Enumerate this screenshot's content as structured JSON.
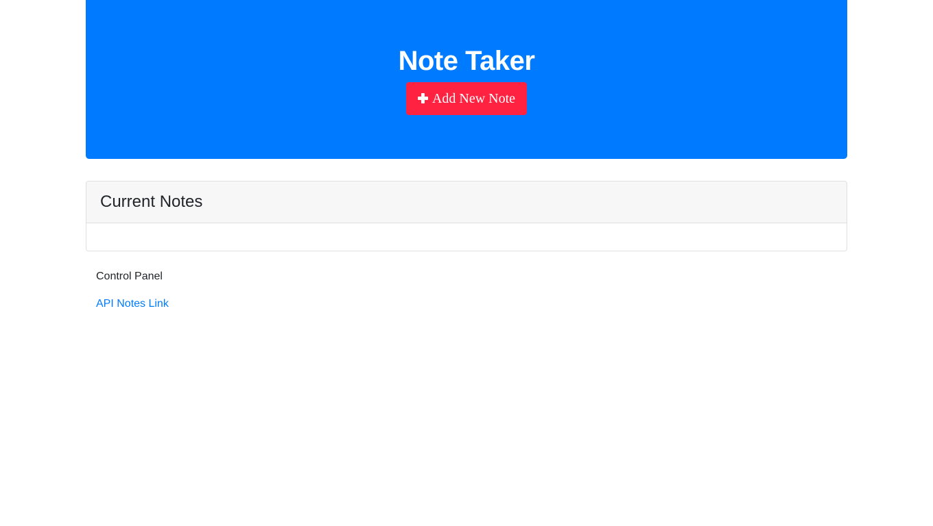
{
  "header": {
    "title": "Note Taker",
    "add_button_label": "Add New Note",
    "add_button_icon": "plus-icon"
  },
  "notes_panel": {
    "title": "Current Notes",
    "notes": []
  },
  "footer": {
    "control_panel_label": "Control Panel",
    "api_link_label": "API Notes Link"
  },
  "colors": {
    "primary": "#007bff",
    "danger": "#ff2241",
    "card_header_bg": "#f7f7f7"
  }
}
